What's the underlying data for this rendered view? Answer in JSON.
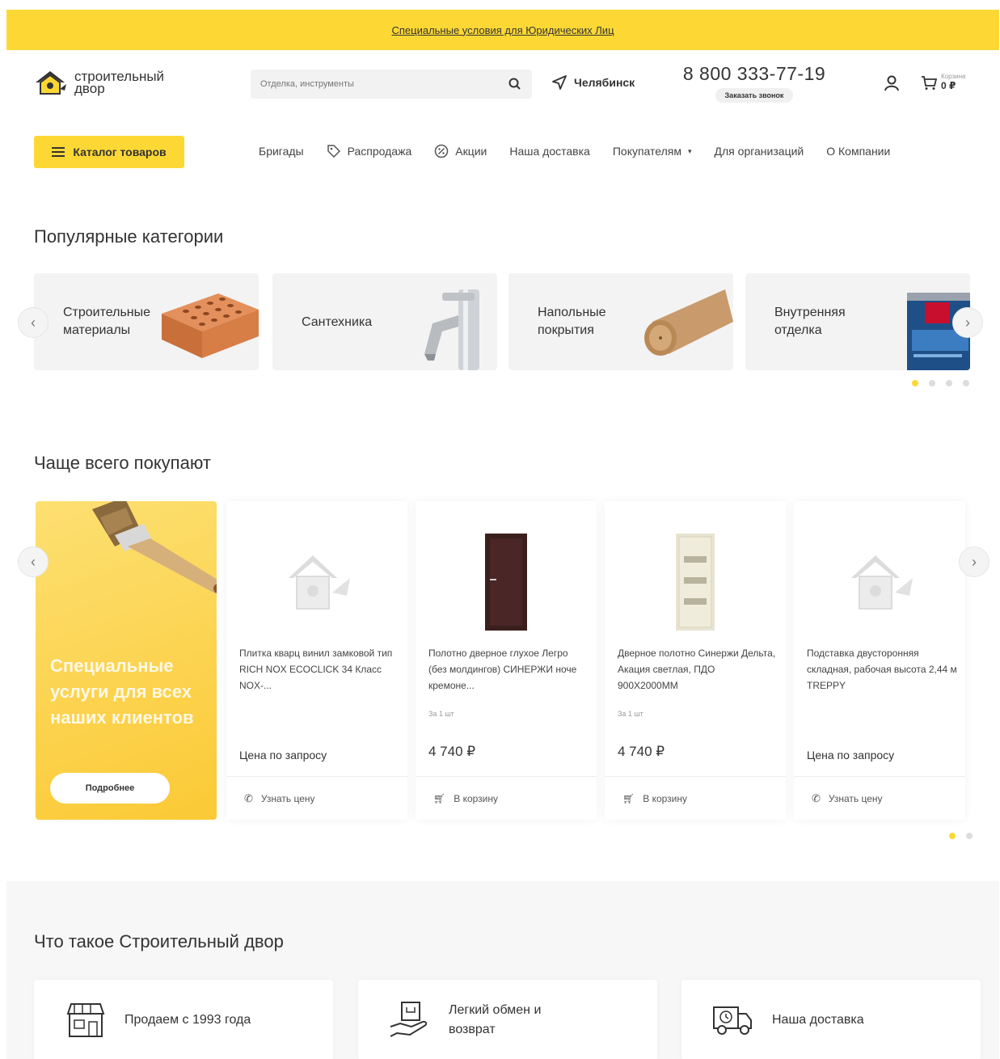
{
  "topbar": {
    "link": "Специальные условия для Юридических Лиц"
  },
  "header": {
    "logo_text": "строительный двор",
    "search_placeholder": "Отделка, инструменты",
    "city": "Челябинск",
    "phone": "8 800 333-77-19",
    "callback": "Заказать звонок",
    "cart_label": "Корзина",
    "cart_value": "0 ₽"
  },
  "nav": {
    "catalog": "Каталог товаров",
    "links": [
      "Бригады",
      "Распродажа",
      "Акции",
      "Наша доставка",
      "Покупателям",
      "Для организаций",
      "О Компании"
    ]
  },
  "popular": {
    "title": "Популярные категории",
    "categories": [
      "Строительные материалы",
      "Сантехника",
      "Напольные покрытия",
      "Внутренняя отделка"
    ]
  },
  "bestsellers": {
    "title": "Чаще всего покупают",
    "promo_title": "Специальные услуги для всех наших клиентов",
    "promo_button": "Подробнее",
    "products": [
      {
        "name": "Плитка кварц винил замковой тип RICH NOX ECOCLICK 34 Класс NOX-...",
        "unit": "",
        "price": "Цена по запросу",
        "action": "Узнать цену"
      },
      {
        "name": "Полотно дверное глухое Легро (без молдингов) СИНЕРЖИ ноче кремоне...",
        "unit": "За 1 шт",
        "price": "4 740 ₽",
        "action": "В корзину"
      },
      {
        "name": "Дверное полотно Синержи Дельта, Акация светлая, ПДО 900Х2000ММ",
        "unit": "За 1 шт",
        "price": "4 740 ₽",
        "action": "В корзину"
      },
      {
        "name": "Подставка двусторонняя складная, рабочая высота 2,44 м TREPPY",
        "unit": "",
        "price": "Цена по запросу",
        "action": "Узнать цену"
      }
    ]
  },
  "about": {
    "title": "Что такое Строительный двор",
    "items": [
      "Продаем с 1993 года",
      "Легкий обмен и возврат",
      "Наша доставка"
    ]
  },
  "colors": {
    "accent": "#fdd835",
    "text": "#333333"
  }
}
